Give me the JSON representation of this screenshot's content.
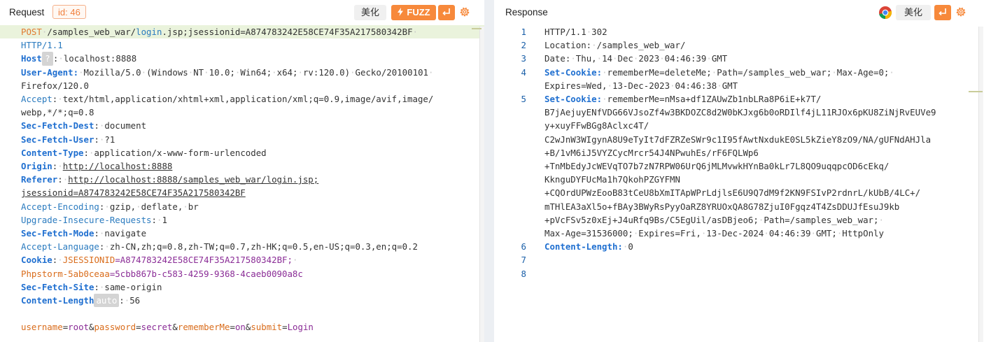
{
  "request": {
    "title": "Request",
    "id_badge": "id: 46",
    "beautify_label": "美化",
    "fuzz_label": "FUZZ",
    "lines": [
      {
        "segments": [
          {
            "t": "POST",
            "c": "m"
          },
          {
            "t": "·",
            "c": "dot"
          },
          {
            "t": "/samples_web_war/"
          },
          {
            "t": "login",
            "c": "k"
          },
          {
            "t": ".jsp;jsessionid=A874783242E58CE74F35A217580342BF"
          },
          {
            "t": "·",
            "c": "dot"
          }
        ],
        "hl": true
      },
      {
        "segments": [
          {
            "t": "HTTP/1.1",
            "c": "k"
          }
        ]
      },
      {
        "segments": [
          {
            "t": "Host",
            "c": "kb"
          },
          {
            "t": "?",
            "c": "qb"
          },
          {
            "t": ":"
          },
          {
            "t": "·",
            "c": "dot"
          },
          {
            "t": "localhost:8888"
          }
        ]
      },
      {
        "segments": [
          {
            "t": "User-Agent:",
            "c": "kb"
          },
          {
            "t": "·",
            "c": "dot"
          },
          {
            "t": "Mozilla/5.0"
          },
          {
            "t": "·",
            "c": "dot"
          },
          {
            "t": "(Windows"
          },
          {
            "t": "·",
            "c": "dot"
          },
          {
            "t": "NT"
          },
          {
            "t": "·",
            "c": "dot"
          },
          {
            "t": "10.0;"
          },
          {
            "t": "·",
            "c": "dot"
          },
          {
            "t": "Win64;"
          },
          {
            "t": "·",
            "c": "dot"
          },
          {
            "t": "x64;"
          },
          {
            "t": "·",
            "c": "dot"
          },
          {
            "t": "rv:120.0)"
          },
          {
            "t": "·",
            "c": "dot"
          },
          {
            "t": "Gecko/20100101"
          },
          {
            "t": "·",
            "c": "dot"
          }
        ]
      },
      {
        "segments": [
          {
            "t": "Firefox/120.0"
          }
        ]
      },
      {
        "segments": [
          {
            "t": "Accept",
            "c": "k"
          },
          {
            "t": ":"
          },
          {
            "t": "·",
            "c": "dot"
          },
          {
            "t": "text/html,application/xhtml+xml,application/xml;q=0.9,image/avif,image/"
          }
        ]
      },
      {
        "segments": [
          {
            "t": "webp,*/*;q=0.8"
          }
        ]
      },
      {
        "segments": [
          {
            "t": "Sec-Fetch-Dest",
            "c": "kb"
          },
          {
            "t": ":"
          },
          {
            "t": "·",
            "c": "dot"
          },
          {
            "t": "document"
          }
        ]
      },
      {
        "segments": [
          {
            "t": "Sec-Fetch-User",
            "c": "kb"
          },
          {
            "t": ":"
          },
          {
            "t": "·",
            "c": "dot"
          },
          {
            "t": "?1"
          }
        ]
      },
      {
        "segments": [
          {
            "t": "Content-Type",
            "c": "kb"
          },
          {
            "t": ":"
          },
          {
            "t": "·",
            "c": "dot"
          },
          {
            "t": "application/x-www-form-urlencoded"
          }
        ]
      },
      {
        "segments": [
          {
            "t": "Origin",
            "c": "kb"
          },
          {
            "t": ":"
          },
          {
            "t": "·",
            "c": "dot"
          },
          {
            "t": "http://localhost:8888",
            "c": "ul"
          }
        ]
      },
      {
        "segments": [
          {
            "t": "Referer",
            "c": "kb"
          },
          {
            "t": ":"
          },
          {
            "t": "·",
            "c": "dot"
          },
          {
            "t": "http://localhost:8888/samples_web_war/login.jsp;",
            "c": "ul"
          }
        ]
      },
      {
        "segments": [
          {
            "t": "jsessionid=A874783242E58CE74F35A217580342BF",
            "c": "ul"
          }
        ]
      },
      {
        "segments": [
          {
            "t": "Accept-Encoding",
            "c": "k"
          },
          {
            "t": ":"
          },
          {
            "t": "·",
            "c": "dot"
          },
          {
            "t": "gzip,"
          },
          {
            "t": "·",
            "c": "dot"
          },
          {
            "t": "deflate,"
          },
          {
            "t": "·",
            "c": "dot"
          },
          {
            "t": "br"
          }
        ]
      },
      {
        "segments": [
          {
            "t": "Upgrade-Insecure-Requests",
            "c": "k"
          },
          {
            "t": ":"
          },
          {
            "t": "·",
            "c": "dot"
          },
          {
            "t": "1"
          }
        ]
      },
      {
        "segments": [
          {
            "t": "Sec-Fetch-Mode",
            "c": "kb"
          },
          {
            "t": ":"
          },
          {
            "t": "·",
            "c": "dot"
          },
          {
            "t": "navigate"
          }
        ]
      },
      {
        "segments": [
          {
            "t": "Accept-Language",
            "c": "k"
          },
          {
            "t": ":"
          },
          {
            "t": "·",
            "c": "dot"
          },
          {
            "t": "zh-CN,zh;q=0.8,zh-TW;q=0.7,zh-HK;q=0.5,en-US;q=0.3,en;q=0.2"
          }
        ]
      },
      {
        "segments": [
          {
            "t": "Cookie",
            "c": "kb"
          },
          {
            "t": ":"
          },
          {
            "t": "·",
            "c": "dot"
          },
          {
            "t": "JSESSIONID",
            "c": "o"
          },
          {
            "t": "=A874783242E58CE74F35A217580342BF;",
            "c": "pu"
          },
          {
            "t": "·",
            "c": "dot"
          }
        ]
      },
      {
        "segments": [
          {
            "t": "Phpstorm-5ab0ceaa",
            "c": "o"
          },
          {
            "t": "=5cbb867b-c583-4259-9368-4caeb0090a8c",
            "c": "pu"
          }
        ]
      },
      {
        "segments": [
          {
            "t": "Sec-Fetch-Site",
            "c": "kb"
          },
          {
            "t": ":"
          },
          {
            "t": "·",
            "c": "dot"
          },
          {
            "t": "same-origin"
          }
        ]
      },
      {
        "segments": [
          {
            "t": "Content-Length",
            "c": "kb"
          },
          {
            "t": "auto",
            "c": "ab"
          },
          {
            "t": ":"
          },
          {
            "t": "·",
            "c": "dot"
          },
          {
            "t": "56"
          }
        ]
      },
      {
        "segments": []
      },
      {
        "segments": [
          {
            "t": "username",
            "c": "o"
          },
          {
            "t": "="
          },
          {
            "t": "root",
            "c": "pu"
          },
          {
            "t": "&"
          },
          {
            "t": "password",
            "c": "o"
          },
          {
            "t": "="
          },
          {
            "t": "secret",
            "c": "pu"
          },
          {
            "t": "&"
          },
          {
            "t": "rememberMe",
            "c": "o"
          },
          {
            "t": "="
          },
          {
            "t": "on",
            "c": "pu"
          },
          {
            "t": "&"
          },
          {
            "t": "submit",
            "c": "o"
          },
          {
            "t": "="
          },
          {
            "t": "Login",
            "c": "pu"
          }
        ]
      }
    ]
  },
  "response": {
    "title": "Response",
    "beautify_label": "美化",
    "lines": [
      {
        "n": "1",
        "segments": [
          {
            "t": "HTTP/1.1"
          },
          {
            "t": "·",
            "c": "dot"
          },
          {
            "t": "302"
          }
        ]
      },
      {
        "n": "2",
        "segments": [
          {
            "t": "Location:"
          },
          {
            "t": "·",
            "c": "dot"
          },
          {
            "t": "/samples_web_war/"
          }
        ]
      },
      {
        "n": "3",
        "segments": [
          {
            "t": "Date:"
          },
          {
            "t": "·",
            "c": "dot"
          },
          {
            "t": "Thu,"
          },
          {
            "t": "·",
            "c": "dot"
          },
          {
            "t": "14"
          },
          {
            "t": "·",
            "c": "dot"
          },
          {
            "t": "Dec"
          },
          {
            "t": "·",
            "c": "dot"
          },
          {
            "t": "2023"
          },
          {
            "t": "·",
            "c": "dot"
          },
          {
            "t": "04:46:39"
          },
          {
            "t": "·",
            "c": "dot"
          },
          {
            "t": "GMT"
          }
        ]
      },
      {
        "n": "4",
        "segments": [
          {
            "t": "Set-Cookie:",
            "c": "kb"
          },
          {
            "t": "·",
            "c": "dot"
          },
          {
            "t": "rememberMe=deleteMe;"
          },
          {
            "t": "·",
            "c": "dot"
          },
          {
            "t": "Path=/samples_web_war;"
          },
          {
            "t": "·",
            "c": "dot"
          },
          {
            "t": "Max-Age=0;"
          },
          {
            "t": "·",
            "c": "dot"
          }
        ]
      },
      {
        "n": "",
        "segments": [
          {
            "t": "Expires=Wed,"
          },
          {
            "t": "·",
            "c": "dot"
          },
          {
            "t": "13-Dec-2023"
          },
          {
            "t": "·",
            "c": "dot"
          },
          {
            "t": "04:46:38"
          },
          {
            "t": "·",
            "c": "dot"
          },
          {
            "t": "GMT"
          }
        ]
      },
      {
        "n": "5",
        "segments": [
          {
            "t": "Set-Cookie:",
            "c": "kb"
          },
          {
            "t": "·",
            "c": "dot"
          },
          {
            "t": "rememberMe=nMsa+df1ZAUwZb1nbLRa8P6iE+k7T/"
          }
        ]
      },
      {
        "n": "",
        "segments": [
          {
            "t": "B7jAejuyENfVDG66VJsoZf4w3BKDOZC8d2W0bKJxg6b0oRDIlf4jL11RJOx6pKU8ZiNjRvEUVe9"
          }
        ]
      },
      {
        "n": "",
        "segments": [
          {
            "t": "y+xuyFFwBGg8Aclxc4T/"
          }
        ]
      },
      {
        "n": "",
        "segments": [
          {
            "t": "C2wJnW3WIgynA8U9eTyIt7dFZRZeSWr9c1I95fAwtNxdukE0SL5kZieY8zO9/NA/gUFNdAHJla"
          }
        ]
      },
      {
        "n": "",
        "segments": [
          {
            "t": "+B/1vM6iJ5VYZCycMrcr54J4NPwuhEs/rF6FQLWp6"
          }
        ]
      },
      {
        "n": "",
        "segments": [
          {
            "t": "+TnMbEdyJcWEVqTO7b7zN7RPW06UrQ6jMLMvwkHYnBa0kLr7L8QO9uqqpcOD6cEkq/"
          }
        ]
      },
      {
        "n": "",
        "segments": [
          {
            "t": "KknguDYFUcMa1h7QkohPZGYFMN"
          }
        ]
      },
      {
        "n": "",
        "segments": [
          {
            "t": "+CQOrdUPWzEooB83tCeU8bXmITApWPrLdjlsE6U9Q7dM9f2KN9FSIvP2rdnrL/kUbB/4LC+/"
          }
        ]
      },
      {
        "n": "",
        "segments": [
          {
            "t": "mTHlEA3aXl5o+fBAy3BWyRsPyyOaRZ8YRUOxQA8G78ZjuI0Fgqz4T4ZsDDUJfEsuJ9kb"
          }
        ]
      },
      {
        "n": "",
        "segments": [
          {
            "t": "+pVcFSv5z0xEj+J4uRfq9Bs/C5EgUil/asDBjeo6;"
          },
          {
            "t": "·",
            "c": "dot"
          },
          {
            "t": "Path=/samples_web_war;"
          },
          {
            "t": "·",
            "c": "dot"
          }
        ]
      },
      {
        "n": "",
        "segments": [
          {
            "t": "Max-Age=31536000;"
          },
          {
            "t": "·",
            "c": "dot"
          },
          {
            "t": "Expires=Fri,"
          },
          {
            "t": "·",
            "c": "dot"
          },
          {
            "t": "13-Dec-2024"
          },
          {
            "t": "·",
            "c": "dot"
          },
          {
            "t": "04:46:39"
          },
          {
            "t": "·",
            "c": "dot"
          },
          {
            "t": "GMT;"
          },
          {
            "t": "·",
            "c": "dot"
          },
          {
            "t": "HttpOnly"
          }
        ]
      },
      {
        "n": "6",
        "segments": [
          {
            "t": "Content-Length:",
            "c": "kb"
          },
          {
            "t": "·",
            "c": "dot"
          },
          {
            "t": "0"
          }
        ]
      },
      {
        "n": "7",
        "segments": []
      },
      {
        "n": "8",
        "segments": []
      }
    ]
  },
  "icons": {
    "fuzz_icon": "lightning-icon",
    "send_icon": "return-icon",
    "settings_icon": "gear-icon",
    "browser_icon": "chrome-icon"
  },
  "colors": {
    "accent_orange": "#f7893b",
    "key_blue": "#1f6fd0",
    "param_orange": "#d96c1b",
    "value_purple": "#8a2c96",
    "line_highlight": "#eaf3dc"
  }
}
